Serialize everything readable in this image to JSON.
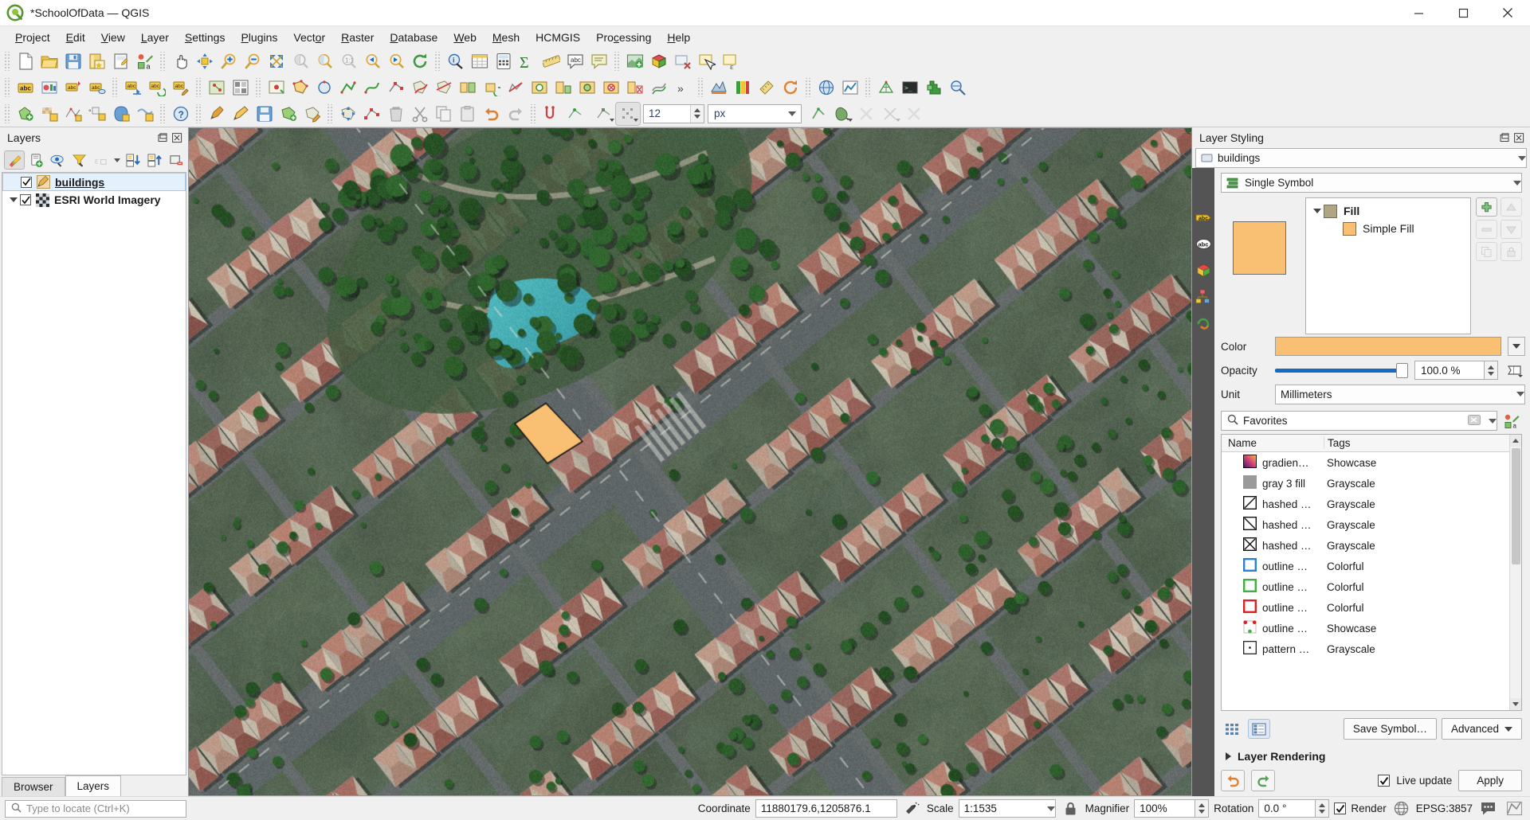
{
  "window": {
    "title": "*SchoolOfData — QGIS",
    "minimize": "minimize",
    "maximize": "maximize",
    "close": "close"
  },
  "menubar": {
    "items": [
      {
        "label": "Project",
        "accel": "P"
      },
      {
        "label": "Edit",
        "accel": "E"
      },
      {
        "label": "View",
        "accel": "V"
      },
      {
        "label": "Layer",
        "accel": "L"
      },
      {
        "label": "Settings",
        "accel": "S"
      },
      {
        "label": "Plugins",
        "accel": "P"
      },
      {
        "label": "Vector",
        "accel": "o"
      },
      {
        "label": "Raster",
        "accel": "R"
      },
      {
        "label": "Database",
        "accel": "D"
      },
      {
        "label": "Web",
        "accel": "W"
      },
      {
        "label": "Mesh",
        "accel": "M"
      },
      {
        "label": "HCMGIS",
        "accel": ""
      },
      {
        "label": "Processing",
        "accel": "c"
      },
      {
        "label": "Help",
        "accel": "H"
      }
    ]
  },
  "left_panel": {
    "title": "Layers",
    "toolbar": [
      {
        "name": "open-layer-styling-panel",
        "enabled": true
      },
      {
        "name": "add-group",
        "enabled": true
      },
      {
        "name": "manage-map-themes",
        "enabled": true
      },
      {
        "name": "filter-legend",
        "enabled": true
      },
      {
        "name": "filter-legend-by-expression",
        "enabled": false
      },
      {
        "name": "expand-all",
        "enabled": true
      },
      {
        "name": "collapse-all",
        "enabled": true
      },
      {
        "name": "remove-layer",
        "enabled": true
      }
    ],
    "layers": [
      {
        "name": "buildings",
        "checked": true,
        "selected": true,
        "icon": "edit-pencil-layer-icon",
        "expandable": false
      },
      {
        "name": "ESRI World Imagery",
        "checked": true,
        "selected": false,
        "icon": "raster-checker-icon",
        "expandable": true
      }
    ],
    "tabs": [
      {
        "label": "Browser",
        "active": false
      },
      {
        "label": "Layers",
        "active": true
      }
    ]
  },
  "right_panel": {
    "title": "Layer Styling",
    "layer_selector": "buildings",
    "renderer": "Single Symbol",
    "symbol_tree": [
      {
        "label": "Fill",
        "level": 0,
        "color": "#b0a582",
        "bold": true
      },
      {
        "label": "Simple Fill",
        "level": 1,
        "color": "#f9bf72",
        "bold": false
      }
    ],
    "preview_color": "#f9bf72",
    "color_label": "Color",
    "color_value": "#f9bf72",
    "opacity_label": "Opacity",
    "opacity_value": "100.0 %",
    "unit_label": "Unit",
    "unit_value": "Millimeters",
    "search_placeholder": "Favorites",
    "search_value": "Favorites",
    "table_headers": [
      "Name",
      "Tags"
    ],
    "symbols": [
      {
        "name": "gradien…",
        "tags": "Showcase",
        "swatch": "gradient"
      },
      {
        "name": "gray 3 fill",
        "tags": "Grayscale",
        "swatch": "gray"
      },
      {
        "name": "hashed …",
        "tags": "Grayscale",
        "swatch": "hash-fwd"
      },
      {
        "name": "hashed …",
        "tags": "Grayscale",
        "swatch": "hash-back"
      },
      {
        "name": "hashed …",
        "tags": "Grayscale",
        "swatch": "hash-cross"
      },
      {
        "name": "outline …",
        "tags": "Colorful",
        "swatch": "outline-blue"
      },
      {
        "name": "outline …",
        "tags": "Colorful",
        "swatch": "outline-green"
      },
      {
        "name": "outline …",
        "tags": "Colorful",
        "swatch": "outline-red"
      },
      {
        "name": "outline …",
        "tags": "Showcase",
        "swatch": "outline-dots"
      },
      {
        "name": "pattern …",
        "tags": "Grayscale",
        "swatch": "pattern-dot"
      }
    ],
    "save_symbol_label": "Save Symbol…",
    "advanced_label": "Advanced",
    "layer_rendering_label": "Layer Rendering",
    "live_update_label": "Live update",
    "live_update_checked": true,
    "apply_label": "Apply"
  },
  "statusbar": {
    "locator_placeholder": "Type to locate (Ctrl+K)",
    "coordinate_label": "Coordinate",
    "coordinate_value": "11880179.6,1205876.1",
    "scale_label": "Scale",
    "scale_value": "1:1535",
    "magnifier_label": "Magnifier",
    "magnifier_value": "100%",
    "rotation_label": "Rotation",
    "rotation_value": "0.0 °",
    "render_label": "Render",
    "render_checked": true,
    "crs_label": "EPSG:3857"
  },
  "toolbars": {
    "row1": [
      {
        "name": "new-project-icon"
      },
      {
        "name": "open-project-icon"
      },
      {
        "name": "save-project-icon"
      },
      {
        "name": "save-project-as-icon"
      },
      {
        "name": "new-print-layout-icon"
      },
      {
        "name": "style-manager-icon"
      },
      {
        "sep": true
      },
      {
        "name": "pan-map-icon"
      },
      {
        "name": "pan-to-selection-icon"
      },
      {
        "name": "zoom-in-icon"
      },
      {
        "name": "zoom-out-icon"
      },
      {
        "name": "zoom-full-icon"
      },
      {
        "name": "zoom-to-selection-icon"
      },
      {
        "name": "zoom-to-layer-icon"
      },
      {
        "name": "zoom-native-icon"
      },
      {
        "name": "zoom-last-icon"
      },
      {
        "name": "zoom-next-icon"
      },
      {
        "name": "refresh-icon"
      },
      {
        "sep": true
      },
      {
        "name": "identify-features-icon"
      },
      {
        "name": "open-attribute-table-icon"
      },
      {
        "name": "open-field-calculator-icon"
      },
      {
        "name": "statistical-summary-icon"
      },
      {
        "name": "measure-line-icon"
      },
      {
        "name": "text-annotation-icon"
      },
      {
        "name": "show-map-tips-icon"
      },
      {
        "sep": true
      },
      {
        "name": "new-map-view-icon"
      },
      {
        "name": "new-3d-map-view-icon"
      },
      {
        "name": "deselect-features-icon"
      },
      {
        "name": "select-features-icon"
      },
      {
        "name": "select-by-expression-icon"
      }
    ],
    "row2": [
      {
        "name": "label-toggle-icon"
      },
      {
        "name": "layer-diagram-icon"
      },
      {
        "name": "pin-labels-icon"
      },
      {
        "name": "show-hide-labels-icon"
      },
      {
        "sep": true
      },
      {
        "name": "move-label-icon"
      },
      {
        "name": "rotate-label-icon"
      },
      {
        "name": "change-label-icon"
      },
      {
        "sep": true
      },
      {
        "name": "georeferencer-icon"
      },
      {
        "name": "raster-calculator-icon"
      },
      {
        "sep": true
      },
      {
        "name": "digitize-point-icon"
      },
      {
        "name": "add-polygon-feature-icon"
      },
      {
        "name": "add-circle-icon"
      },
      {
        "name": "add-line-icon"
      },
      {
        "name": "add-curve-icon"
      },
      {
        "name": "vertex-tool-icon"
      },
      {
        "name": "reshape-features-icon"
      },
      {
        "name": "split-features-icon"
      },
      {
        "name": "merge-features-icon"
      },
      {
        "name": "rotate-feature-icon"
      },
      {
        "name": "simplify-feature-icon"
      },
      {
        "name": "add-ring-icon"
      },
      {
        "name": "add-part-icon"
      },
      {
        "name": "fill-ring-icon"
      },
      {
        "name": "delete-ring-icon"
      },
      {
        "name": "delete-part-icon"
      },
      {
        "name": "offset-curve-icon"
      },
      {
        "name": "more-tools-icon"
      },
      {
        "sep": true
      },
      {
        "name": "plugin-processing-icon"
      },
      {
        "name": "plugin-colors-icon"
      },
      {
        "name": "plugin-measure-icon"
      },
      {
        "name": "plugin-refresh-icon"
      },
      {
        "sep": true
      },
      {
        "name": "globe-icon"
      },
      {
        "name": "plot-icon"
      },
      {
        "sep": true
      },
      {
        "name": "mesh-icon"
      },
      {
        "name": "python-console-icon"
      },
      {
        "name": "plugin-manager-icon"
      },
      {
        "name": "metasearch-icon"
      }
    ],
    "row3": [
      {
        "name": "add-vector-layer-icon"
      },
      {
        "name": "add-raster-layer-icon"
      },
      {
        "name": "add-mesh-layer-icon"
      },
      {
        "name": "add-delimited-text-layer-icon"
      },
      {
        "name": "add-postgis-layer-icon"
      },
      {
        "name": "add-wms-layer-icon"
      },
      {
        "sep": true
      },
      {
        "name": "help-contents-icon"
      },
      {
        "sep": true
      },
      {
        "name": "current-edits-icon"
      },
      {
        "name": "toggle-editing-icon"
      },
      {
        "name": "save-layer-edits-icon"
      },
      {
        "name": "add-feature-icon"
      },
      {
        "name": "modify-attributes-icon"
      },
      {
        "sep": true
      },
      {
        "name": "move-feature-icon"
      },
      {
        "name": "node-tool-icon"
      },
      {
        "name": "delete-selected-icon"
      },
      {
        "name": "cut-features-icon"
      },
      {
        "name": "copy-features-icon"
      },
      {
        "name": "paste-features-icon"
      },
      {
        "name": "undo-icon"
      },
      {
        "name": "redo-icon"
      },
      {
        "sep": true
      },
      {
        "name": "snapping-options-icon"
      },
      {
        "name": "snapping-mode-icon"
      }
    ],
    "text_size_value": "12",
    "text_unit_value": "px"
  }
}
